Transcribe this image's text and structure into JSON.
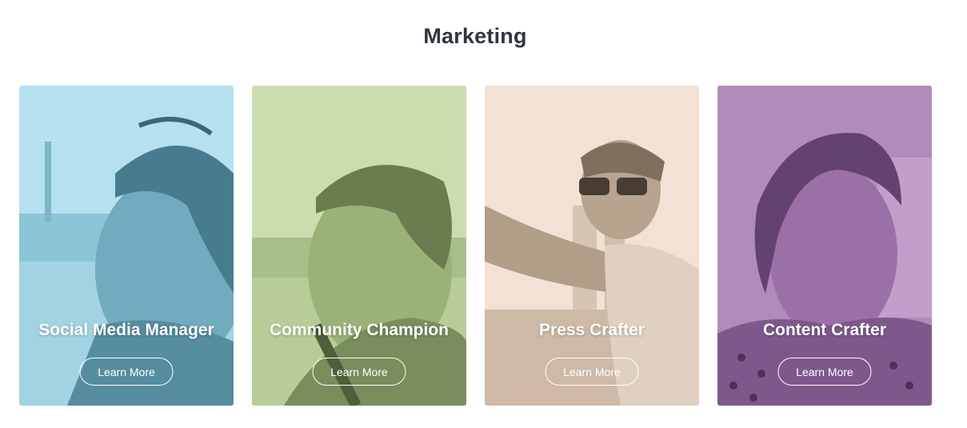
{
  "section": {
    "title": "Marketing"
  },
  "cards": [
    {
      "title": "Social Media Manager",
      "button_label": "Learn More",
      "tint": "#7fc6dd",
      "shade": "#3d6f80"
    },
    {
      "title": "Community Champion",
      "button_label": "Learn More",
      "tint": "#b7cf92",
      "shade": "#5e6f45"
    },
    {
      "title": "Press Crafter",
      "button_label": "Learn More",
      "tint": "#ead3bf",
      "shade": "#8f7c6b"
    },
    {
      "title": "Content Crafter",
      "button_label": "Learn More",
      "tint": "#9d6fa8",
      "shade": "#5a3a66"
    }
  ]
}
